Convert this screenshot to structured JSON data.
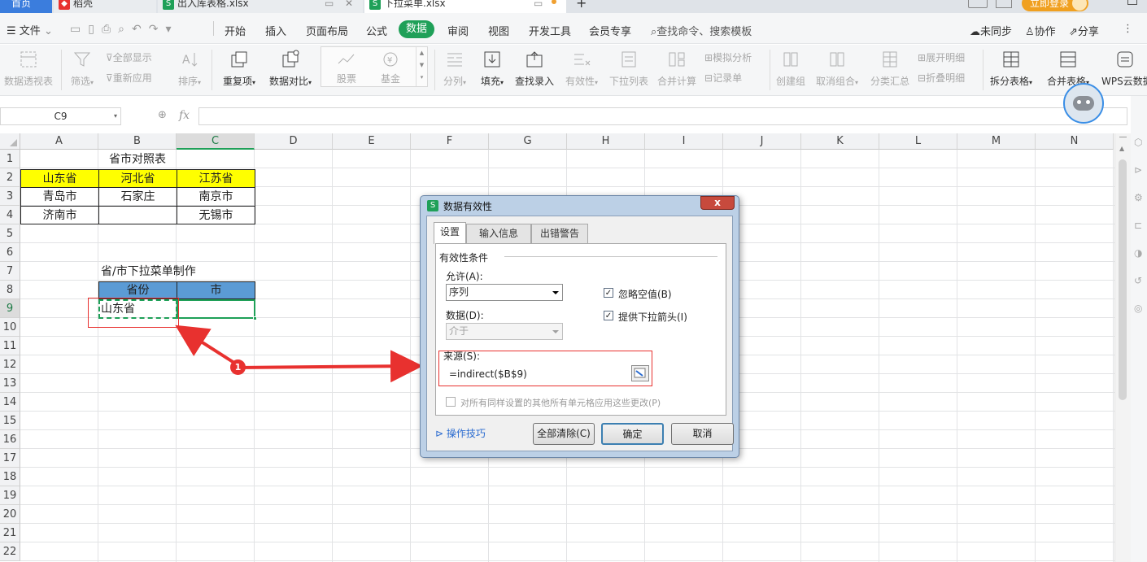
{
  "tabs": {
    "home": "首页",
    "docer": "稻壳",
    "file1": "出入库表格.xlsx",
    "file2": "下拉菜单.xlsx",
    "add": "+",
    "login": "立即登录"
  },
  "menu": {
    "file": "文件",
    "items": [
      "开始",
      "插入",
      "页面布局",
      "公式",
      "数据",
      "审阅",
      "视图",
      "开发工具",
      "会员专享"
    ],
    "search": "查找命令、搜索模板",
    "sync": "未同步",
    "collab": "协作",
    "share": "分享"
  },
  "ribbon": {
    "pivot": "数据透视表",
    "filter": "筛选",
    "show_all": "全部显示",
    "reapply": "重新应用",
    "sort": "排序",
    "dup": "重复项",
    "compare": "数据对比",
    "stock": "股票",
    "fund": "基金",
    "split": "分列",
    "fill": "填充",
    "lookup": "查找录入",
    "validity": "有效性",
    "dropdown": "下拉列表",
    "consolidate": "合并计算",
    "simulate": "模拟分析",
    "record": "记录单",
    "group": "创建组",
    "ungroup": "取消组合",
    "subtotal": "分类汇总",
    "expand": "展开明细",
    "collapse": "折叠明细",
    "split_table": "拆分表格",
    "merge_table": "合并表格",
    "wps_cloud": "WPS云数据"
  },
  "formula": {
    "namebox": "C9",
    "fx": "fx",
    "value": ""
  },
  "columns": [
    "A",
    "B",
    "C",
    "D",
    "E",
    "F",
    "G",
    "H",
    "I",
    "J",
    "K",
    "L",
    "M",
    "N"
  ],
  "rows": [
    "1",
    "2",
    "3",
    "4",
    "5",
    "6",
    "7",
    "8",
    "9",
    "10",
    "11",
    "12",
    "13",
    "14",
    "15",
    "16",
    "17",
    "18",
    "19",
    "20",
    "21",
    "22"
  ],
  "cells": {
    "title": "省市对照表",
    "a2": "山东省",
    "b2": "河北省",
    "c2": "江苏省",
    "a3": "青岛市",
    "b3": "石家庄",
    "c3": "南京市",
    "a4": "济南市",
    "c4": "无锡市",
    "b7": "省/市下拉菜单制作",
    "b8": "省份",
    "c8": "市",
    "b9": "山东省"
  },
  "annotation": {
    "marker": "1"
  },
  "dialog": {
    "title": "数据有效性",
    "close": "x",
    "tabs": [
      "设置",
      "输入信息",
      "出错警告"
    ],
    "section": "有效性条件",
    "allow_label": "允许(A):",
    "allow_value": "序列",
    "data_label": "数据(D):",
    "data_value": "介于",
    "ignore_blank": "忽略空值(B)",
    "ignore_blank_checked": true,
    "dropdown_arrow": "提供下拉箭头(I)",
    "dropdown_arrow_checked": true,
    "source_label": "来源(S):",
    "source_value": "=indirect($B$9)",
    "apply_all": "对所有同样设置的其他所有单元格应用这些更改(P)",
    "tips": "操作技巧",
    "clear_all": "全部清除(C)",
    "ok": "确定",
    "cancel": "取消"
  },
  "colors": {
    "accent_green": "#1fa058",
    "header_yellow": "#ffff00",
    "header_blue": "#5b9bd5",
    "annotation_red": "#e8312f"
  }
}
